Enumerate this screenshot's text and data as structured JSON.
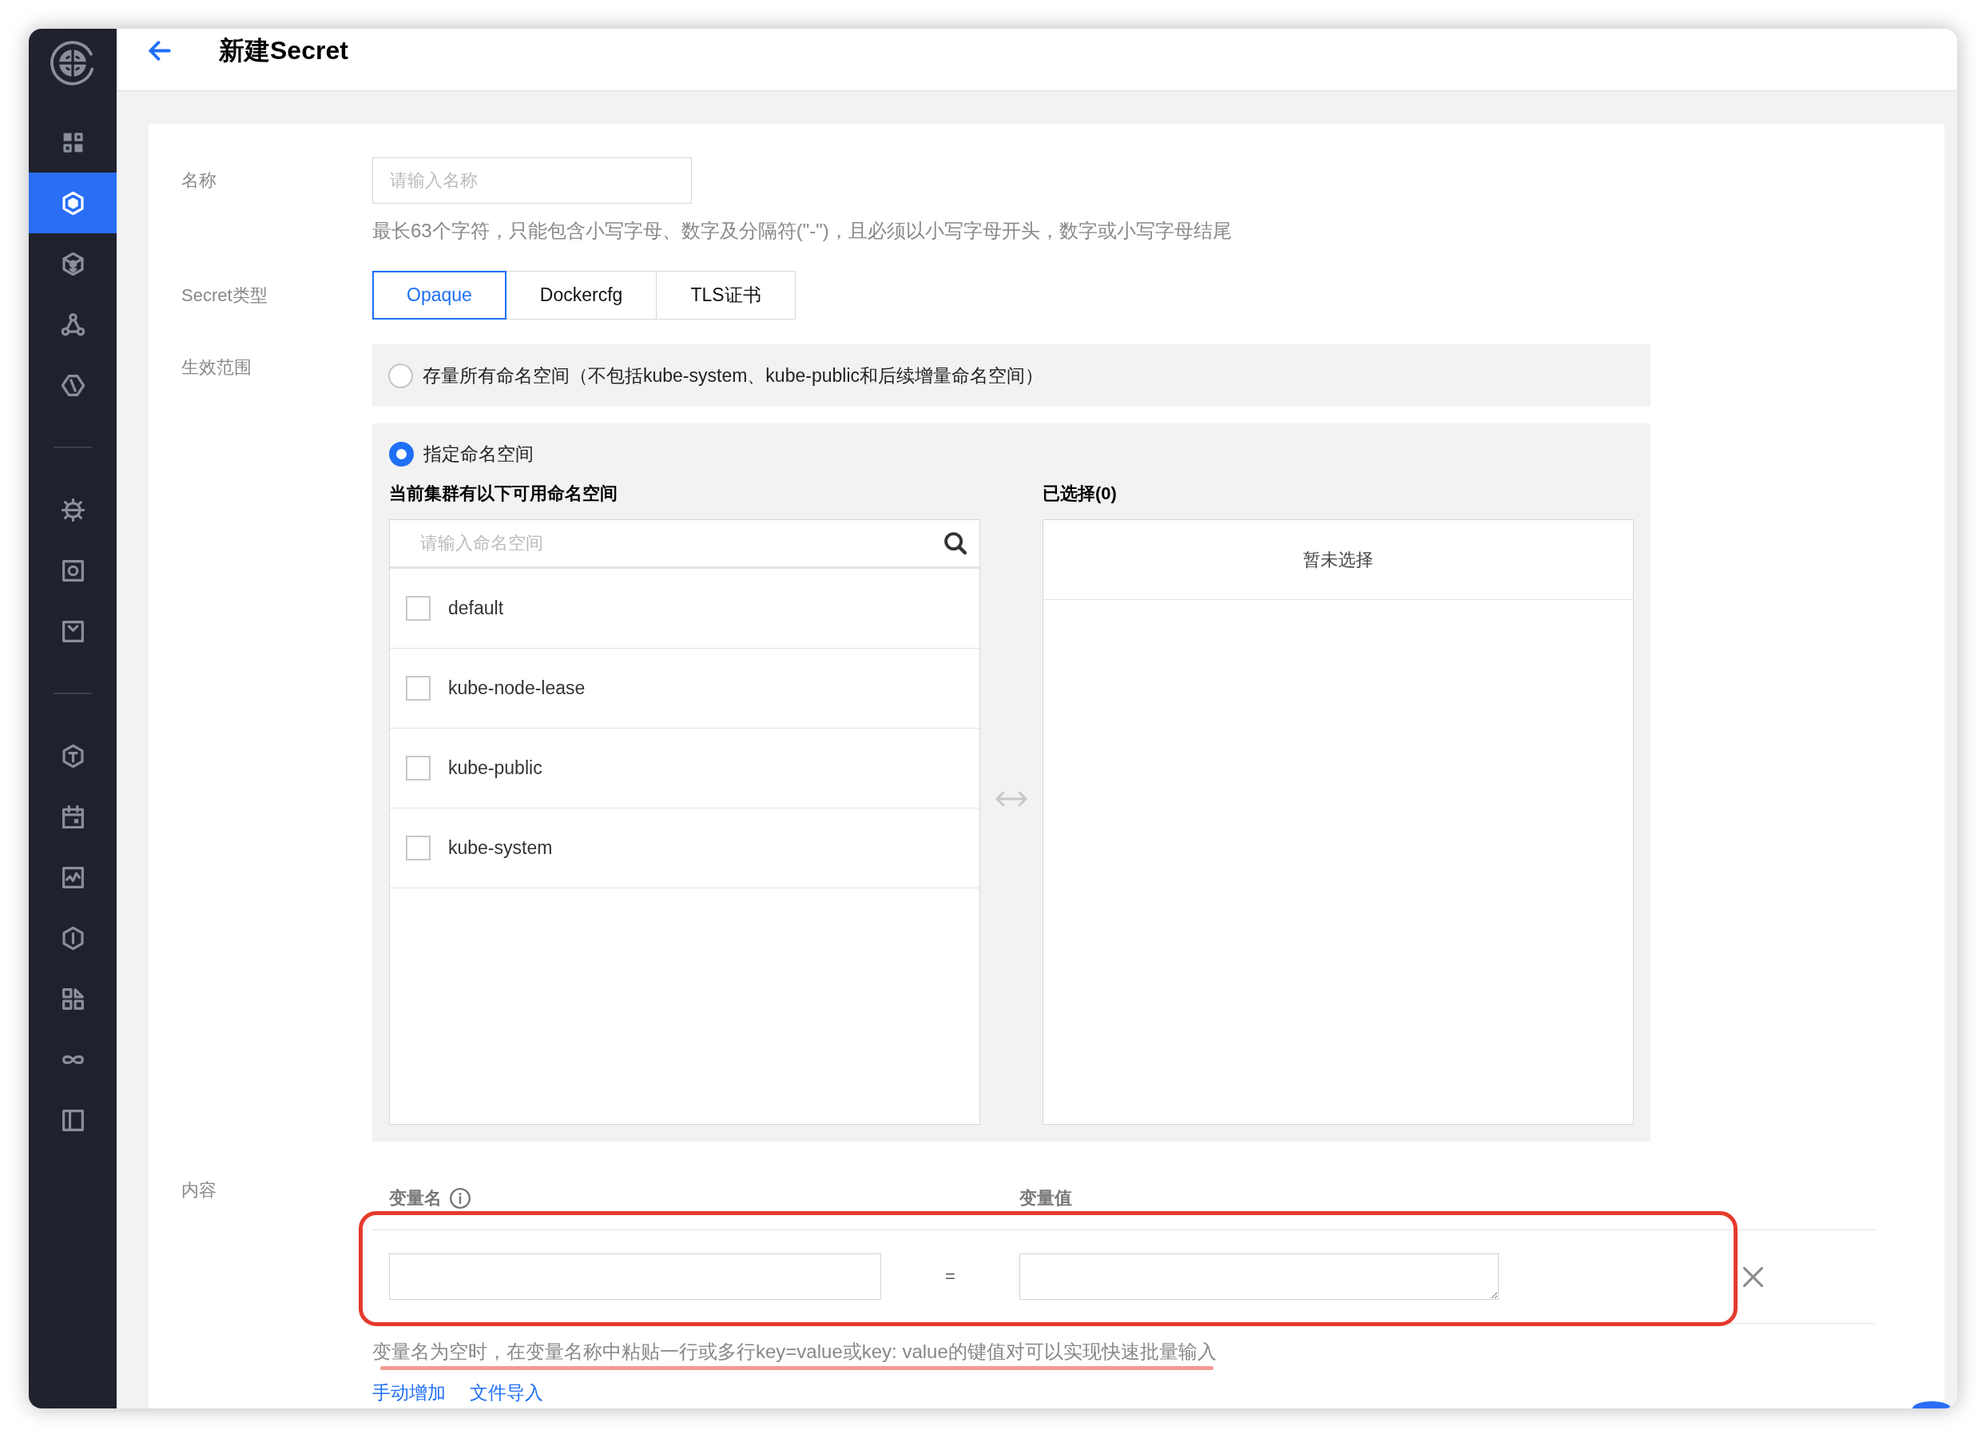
{
  "sidebar": {
    "groups": [
      {
        "items": [
          {
            "selected": false
          },
          {
            "selected": true
          },
          {
            "selected": false
          },
          {
            "selected": false
          },
          {
            "selected": false
          }
        ]
      },
      {
        "items": [
          {
            "selected": false
          },
          {
            "selected": false
          },
          {
            "selected": false
          }
        ]
      },
      {
        "items": [
          {
            "selected": false
          },
          {
            "selected": false
          },
          {
            "selected": false
          },
          {
            "selected": false
          },
          {
            "selected": false
          },
          {
            "selected": false
          },
          {
            "selected": false
          }
        ]
      }
    ]
  },
  "header": {
    "title": "新建Secret"
  },
  "form": {
    "name": {
      "label": "名称",
      "placeholder": "请输入名称",
      "hint": "最长63个字符，只能包含小写字母、数字及分隔符(\"-\")，且必须以小写字母开头，数字或小写字母结尾"
    },
    "secret_type": {
      "label": "Secret类型",
      "tabs": [
        {
          "label": "Opaque",
          "selected": true
        },
        {
          "label": "Dockercfg",
          "selected": false
        },
        {
          "label": "TLS证书",
          "selected": false
        }
      ]
    },
    "scope": {
      "label": "生效范围",
      "options": [
        {
          "label": "存量所有命名空间（不包括kube-system、kube-public和后续增量命名空间）",
          "selected": false
        },
        {
          "label": "指定命名空间",
          "selected": true
        }
      ]
    },
    "namespace_picker": {
      "available_title": "当前集群有以下可用命名空间",
      "search_placeholder": "请输入命名空间",
      "namespaces": [
        {
          "name": "default",
          "checked": false
        },
        {
          "name": "kube-node-lease",
          "checked": false
        },
        {
          "name": "kube-public",
          "checked": false
        },
        {
          "name": "kube-system",
          "checked": false
        }
      ],
      "selected_title": "已选择(0)",
      "empty_text": "暂未选择"
    },
    "content": {
      "label": "内容",
      "columns": [
        {
          "label": "变量名",
          "info": true
        },
        {
          "label": "变量值",
          "info": false
        }
      ],
      "rows": [
        {
          "separator": "="
        }
      ],
      "hint": "变量名为空时，在变量名称中粘贴一行或多行key=value或key: value的键值对可以实现快速批量输入",
      "actions": [
        "手动增加",
        "文件导入"
      ]
    }
  }
}
